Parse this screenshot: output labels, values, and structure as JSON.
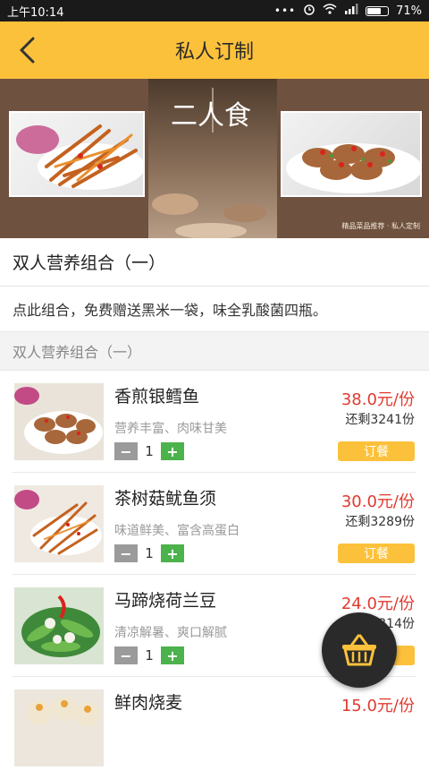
{
  "status_bar": {
    "time": "上午10:14",
    "battery": "71%",
    "battery_level": 0.71
  },
  "header": {
    "title": "私人订制"
  },
  "banner": {
    "vertical_text": "二人食",
    "caption": "精品菜品推荐 · 私人定制"
  },
  "combo": {
    "title": "双人营养组合（一）",
    "description": "点此组合，免费赠送黑米一袋，味全乳酸菌四瓶。",
    "list_header": "双人营养组合（一）"
  },
  "items": [
    {
      "name": "香煎银鳕鱼",
      "subtitle": "营养丰富、肉味甘美",
      "qty": "1",
      "price": "38.0元/份",
      "stock": "还剩3241份",
      "order": "订餐"
    },
    {
      "name": "茶树菇鱿鱼须",
      "subtitle": "味道鲜美、富含高蛋白",
      "qty": "1",
      "price": "30.0元/份",
      "stock": "还剩3289份",
      "order": "订餐"
    },
    {
      "name": "马蹄烧荷兰豆",
      "subtitle": "清凉解暑、爽口解腻",
      "qty": "1",
      "price": "24.0元/份",
      "stock": "还剩3314份",
      "order": "订餐"
    },
    {
      "name": "鲜肉烧麦",
      "price": "15.0元/份"
    }
  ],
  "icons": {
    "back": "back-arrow-icon",
    "cart": "basket-icon",
    "minus": "−",
    "plus": "+"
  },
  "colors": {
    "accent": "#fcc13b",
    "price": "#e03a2f",
    "plus": "#4cb24c",
    "minus": "#9b9b9b"
  }
}
